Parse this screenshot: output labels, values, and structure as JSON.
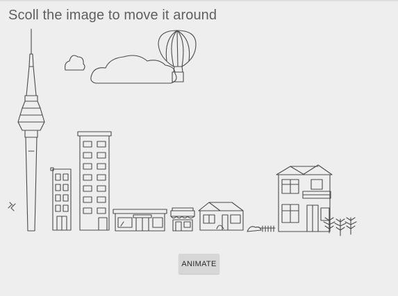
{
  "header": {
    "instruction": "Scoll the image to move it around"
  },
  "actions": {
    "animate_label": "ANIMATE"
  },
  "scene": {
    "description_icons": [
      "sky-tower-icon",
      "cloud-icon",
      "hot-air-balloon-icon",
      "building-icon",
      "house-icon",
      "tree-icon"
    ],
    "stroke_color": "#4a4a4a",
    "background_color": "#eeeeee",
    "button_color": "#d7d7d7"
  }
}
